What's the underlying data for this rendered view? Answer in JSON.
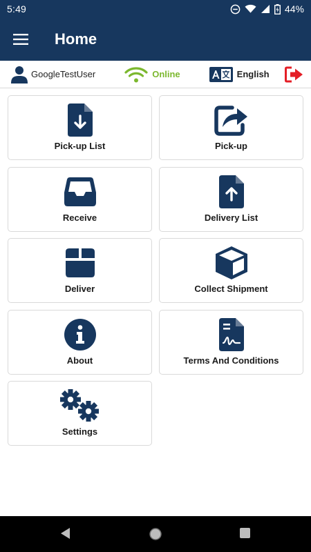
{
  "status_bar": {
    "time": "5:49",
    "battery": "44%"
  },
  "app_bar": {
    "title": "Home"
  },
  "info_bar": {
    "user_name": "GoogleTestUser",
    "connection": "Online",
    "language": "English"
  },
  "colors": {
    "primary": "#17375e",
    "online": "#7cb82f",
    "logout": "#e41e26"
  },
  "tiles": [
    {
      "label": "Pick-up List",
      "icon": "file-download-icon"
    },
    {
      "label": "Pick-up",
      "icon": "share-icon"
    },
    {
      "label": "Receive",
      "icon": "inbox-tray-icon"
    },
    {
      "label": "Delivery List",
      "icon": "file-upload-icon"
    },
    {
      "label": "Deliver",
      "icon": "box-icon"
    },
    {
      "label": "Collect Shipment",
      "icon": "cube-icon"
    },
    {
      "label": "About",
      "icon": "info-icon"
    },
    {
      "label": "Terms And Conditions",
      "icon": "signed-document-icon"
    },
    {
      "label": "Settings",
      "icon": "gears-icon"
    }
  ]
}
